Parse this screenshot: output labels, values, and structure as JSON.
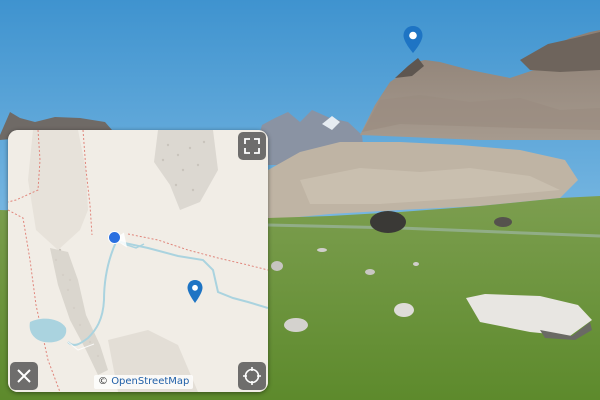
{
  "panorama": {
    "marker_icon": "map-pin-icon"
  },
  "minimap": {
    "attribution_symbol": "©",
    "attribution_link": "OpenStreetMap",
    "expand_icon": "expand-icon",
    "locate_icon": "crosshair-icon",
    "close_icon": "close-icon",
    "marker_icon": "map-pin-icon",
    "current_position_icon": "current-position-icon"
  },
  "colors": {
    "accent": "#1e74c4",
    "position": "#2a6fe0",
    "water": "#aad3df",
    "control_bg": "#505050"
  }
}
